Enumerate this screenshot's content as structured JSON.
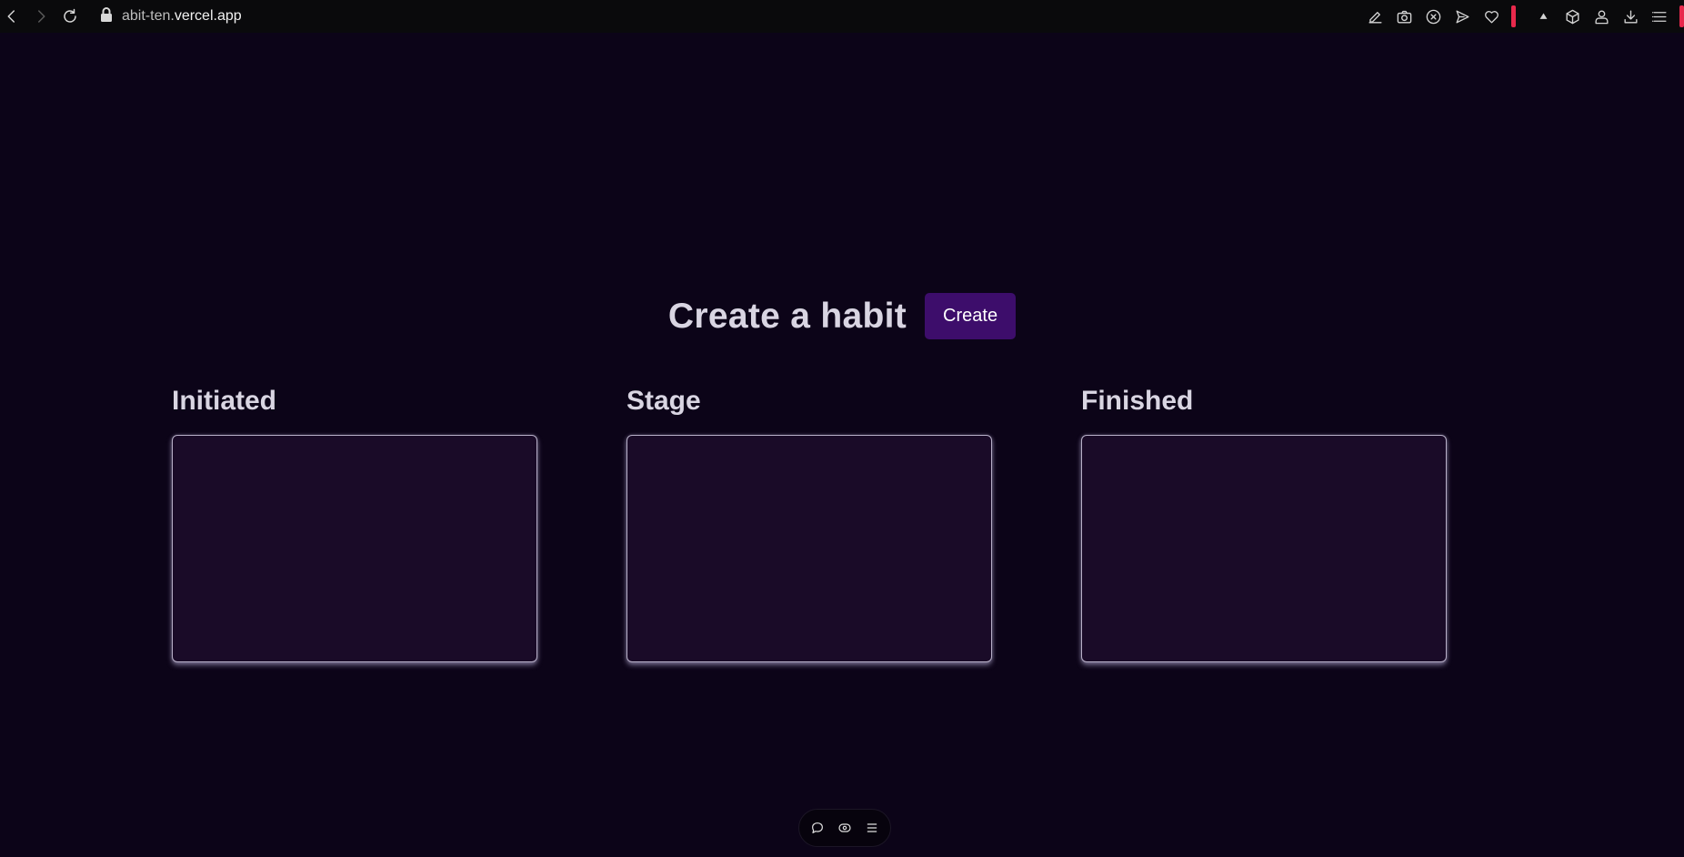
{
  "browser": {
    "url_prefix": "abit-ten.",
    "url_domain": "vercel.app",
    "icons": {
      "back": "chevron-left-icon",
      "forward": "chevron-right-icon",
      "reload": "reload-icon",
      "lock": "lock-icon"
    },
    "toolbar_icons": [
      "edit-icon",
      "camera-icon",
      "x-circle-icon",
      "send-icon",
      "heart-icon",
      "triangle-icon",
      "cube-icon",
      "user-icon",
      "download-icon",
      "menu-icon"
    ],
    "record_color": "#e8294c"
  },
  "hero": {
    "title": "Create a habit",
    "create_label": "Create"
  },
  "columns": [
    {
      "title": "Initiated"
    },
    {
      "title": "Stage"
    },
    {
      "title": "Finished"
    }
  ],
  "floating_toolbar": {
    "icons": [
      "chat-bubble-icon",
      "eye-icon",
      "menu-icon"
    ]
  },
  "colors": {
    "background": "#0c0418",
    "accent": "#3d0d6b",
    "card_fill": "#1a0b28"
  }
}
